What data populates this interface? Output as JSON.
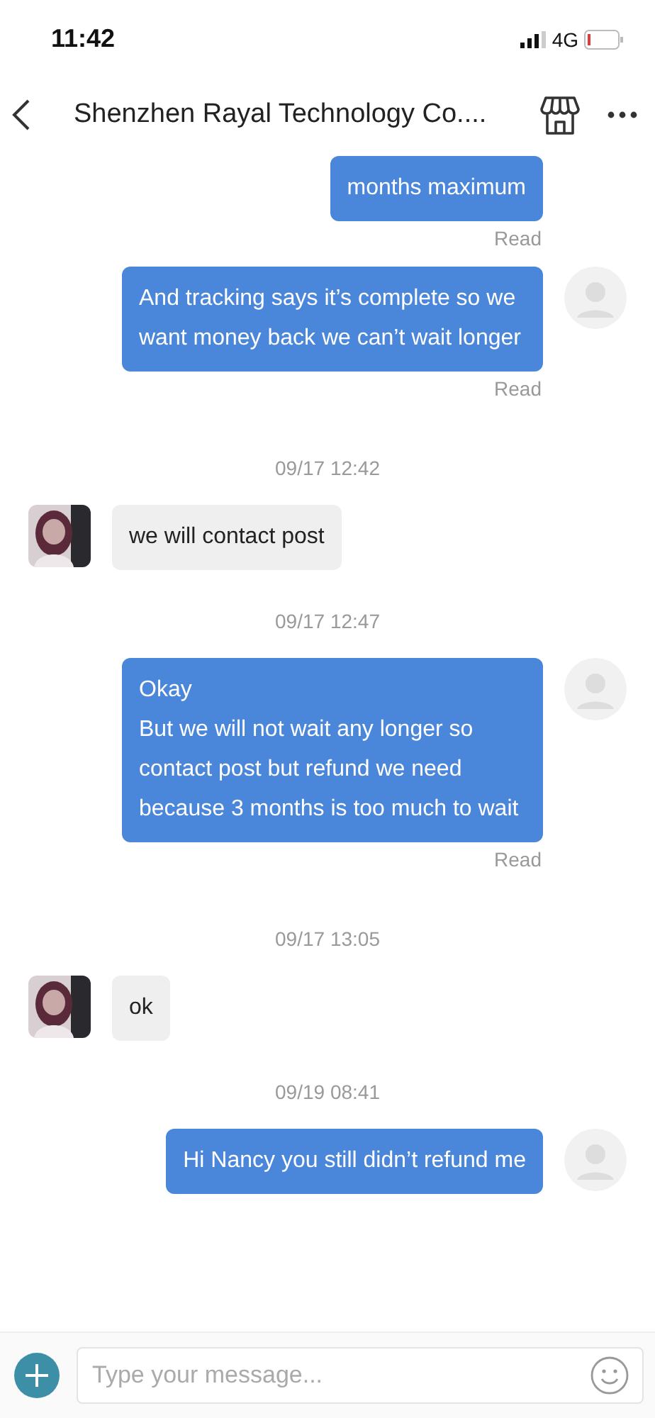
{
  "status_bar": {
    "time": "11:42",
    "network": "4G"
  },
  "header": {
    "title": "Shenzhen Rayal Technology Co...."
  },
  "messages": [
    {
      "kind": "outgoing",
      "text": "months maximum",
      "receipt": "Read"
    },
    {
      "kind": "outgoing",
      "text": "And tracking says it’s complete so we want money back we can’t wait longer",
      "receipt": "Read"
    },
    {
      "kind": "timestamp",
      "text": "09/17 12:42"
    },
    {
      "kind": "incoming",
      "text": "we will contact post"
    },
    {
      "kind": "timestamp",
      "text": "09/17 12:47"
    },
    {
      "kind": "outgoing",
      "text": "Okay\nBut we will not wait any longer so contact post but refund we need because 3 months is too much to wait",
      "receipt": "Read"
    },
    {
      "kind": "timestamp",
      "text": "09/17 13:05"
    },
    {
      "kind": "incoming",
      "text": "ok"
    },
    {
      "kind": "timestamp",
      "text": "09/19 08:41"
    },
    {
      "kind": "outgoing",
      "text": "Hi Nancy you still didn’t refund me"
    }
  ],
  "composer": {
    "placeholder": "Type your message..."
  }
}
